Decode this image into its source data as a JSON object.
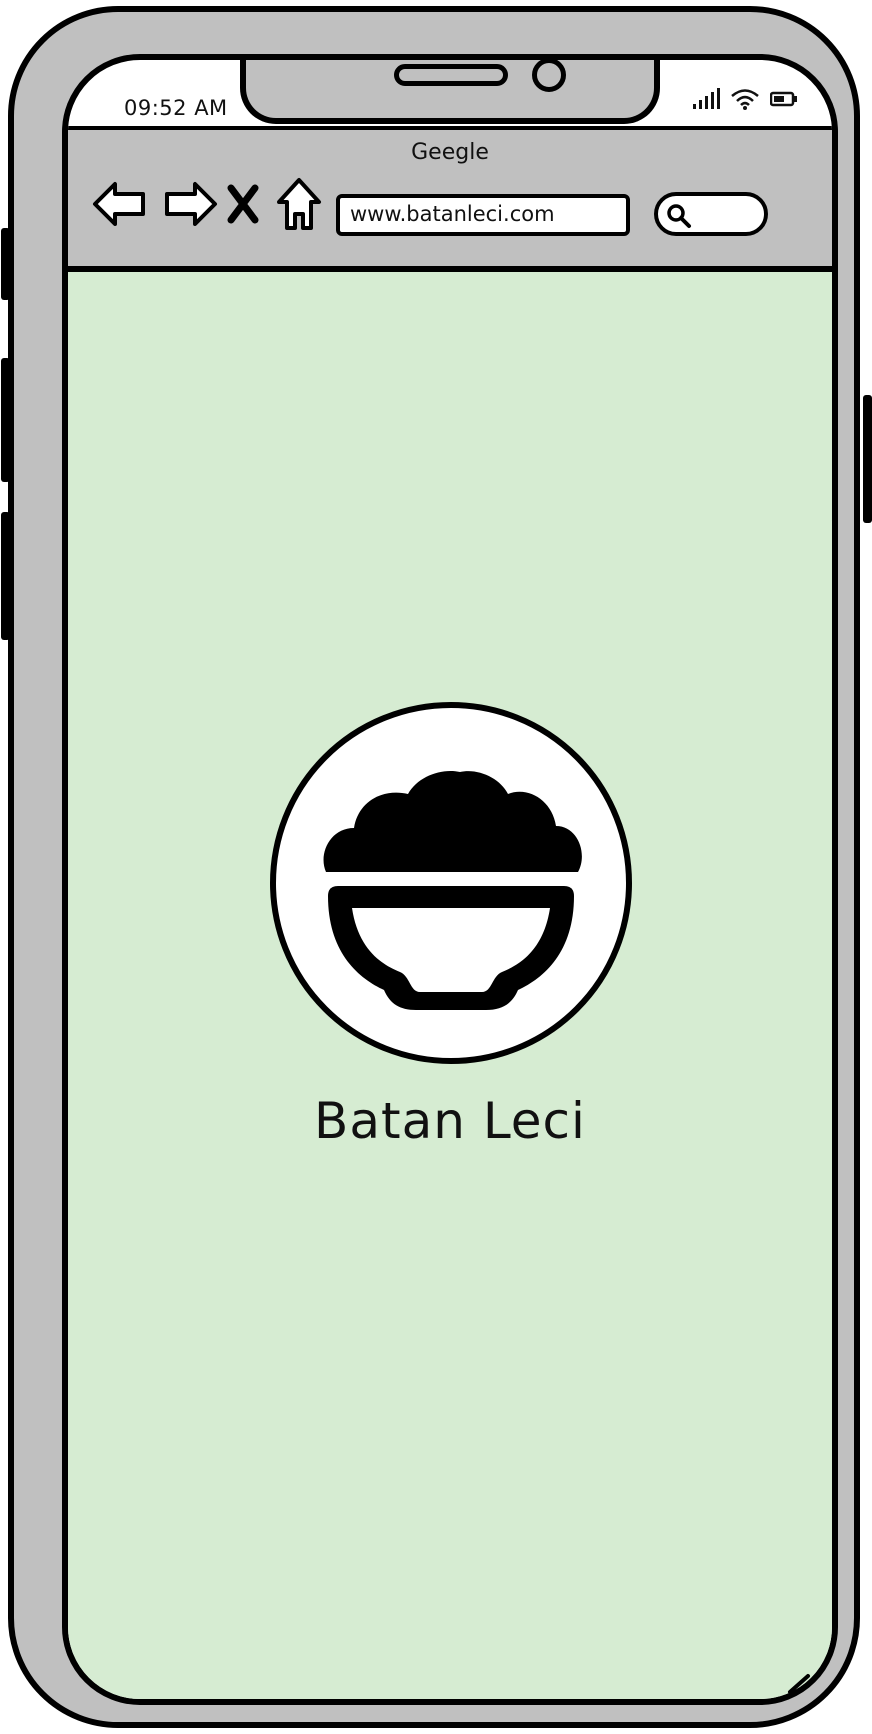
{
  "status_bar": {
    "time": "09:52 AM"
  },
  "browser": {
    "title": "Geegle",
    "address": "www.batanleci.com",
    "icons": {
      "back": "back-arrow-icon",
      "forward": "forward-arrow-icon",
      "stop": "close-icon",
      "home": "home-icon",
      "search": "search-icon"
    }
  },
  "page": {
    "background_color": "#d6ecd2",
    "logo": "rice-bowl-icon",
    "brand_name": "Batan Leci"
  },
  "colors": {
    "device_body": "#c0c0c0",
    "outline": "#000000"
  }
}
